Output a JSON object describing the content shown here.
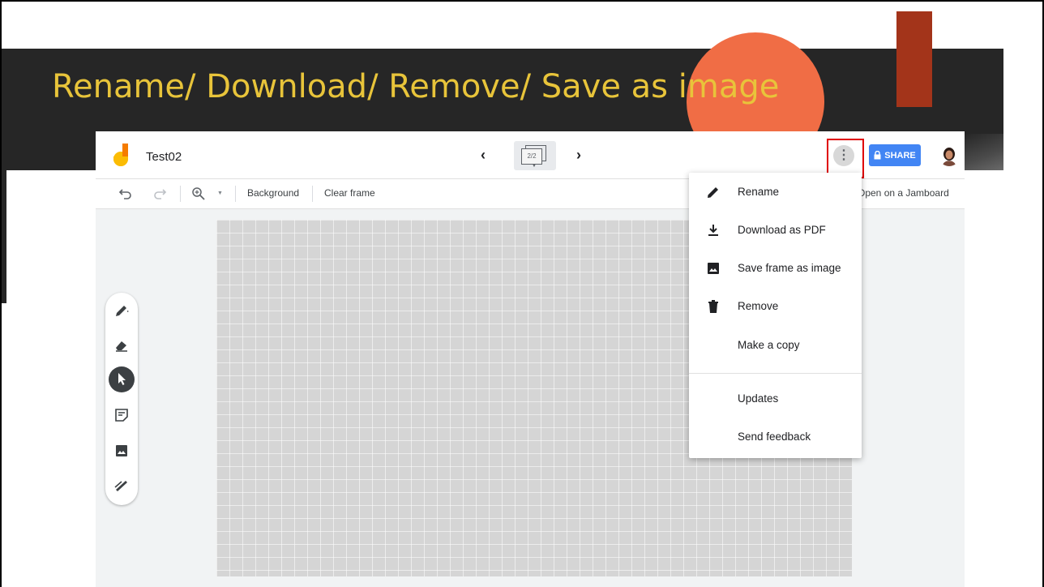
{
  "slide": {
    "title": "Rename/ Download/ Remove/ Save as image",
    "colors": {
      "banner": "#262626",
      "title": "#e8c43a",
      "accent_rect": "#a3341a",
      "accent_circle": "#f06d45"
    }
  },
  "app": {
    "doc_title": "Test02",
    "frame_indicator": "2/2",
    "share_label": "SHARE",
    "icons": {
      "prev": "chevron-left-icon",
      "next": "chevron-right-icon",
      "more": "more-vert-icon",
      "lock": "lock-icon"
    },
    "toolbar": {
      "background_label": "Background",
      "clear_frame_label": "Clear frame",
      "open_jamboard_label": "Open on a Jamboard"
    },
    "side_tools": [
      "pen-icon",
      "eraser-icon",
      "select-icon",
      "sticky-note-icon",
      "image-icon",
      "laser-icon"
    ],
    "menu": {
      "items": [
        {
          "label": "Rename",
          "icon": "pencil-icon"
        },
        {
          "label": "Download as PDF",
          "icon": "download-icon"
        },
        {
          "label": "Save frame as image",
          "icon": "image-icon"
        },
        {
          "label": "Remove",
          "icon": "trash-icon"
        },
        {
          "label": "Make a copy",
          "icon": ""
        },
        {
          "label": "Updates",
          "icon": ""
        },
        {
          "label": "Send feedback",
          "icon": ""
        }
      ]
    },
    "colors": {
      "share": "#4285f4",
      "highlight": "#e00000",
      "canvas": "#d5d5d5"
    }
  }
}
